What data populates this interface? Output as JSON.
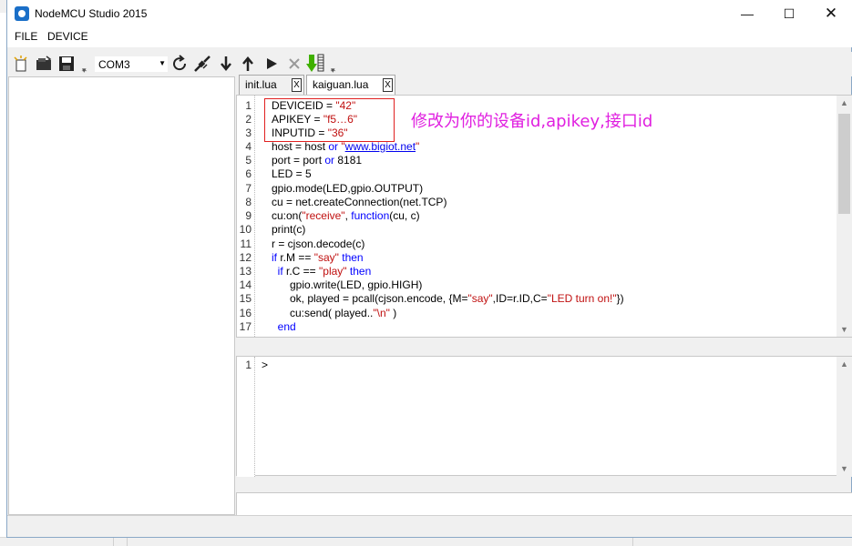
{
  "window": {
    "title": "NodeMCU Studio 2015",
    "minimize_glyph": "—",
    "maximize_glyph": "☐",
    "close_glyph": "✕"
  },
  "menu": {
    "file": "FILE",
    "device": "DEVICE"
  },
  "toolbar": {
    "com_port": "COM3",
    "icons": [
      "new-file-icon",
      "open-file-icon",
      "save-icon",
      "refresh-icon",
      "disconnect-icon",
      "download-icon",
      "upload-icon",
      "run-icon",
      "stop-icon",
      "flash-icon"
    ]
  },
  "tabs": [
    {
      "label": "init.lua",
      "close": "X",
      "active": false
    },
    {
      "label": "kaiguan.lua",
      "close": "X",
      "active": true
    }
  ],
  "editor": {
    "annotation": "修改为你的设备id,apikey,接口id",
    "line_numbers": [
      "1",
      "2",
      "3",
      "4",
      "5",
      "6",
      "7",
      "8",
      "9",
      "10",
      "11",
      "12",
      "13",
      "14",
      "15",
      "16",
      "17"
    ],
    "lines": [
      "DEVICEID = \"42\"",
      "APIKEY = \"f5…6\"",
      "INPUTID = \"36\"",
      "host = host or \"www.bigiot.net\"",
      "port = port or 8181",
      "LED = 5",
      "gpio.mode(LED,gpio.OUTPUT)",
      "cu = net.createConnection(net.TCP)",
      "cu:on(\"receive\", function(cu, c)",
      "print(c)",
      "r = cjson.decode(c)",
      "if r.M == \"say\" then",
      "  if r.C == \"play\" then",
      "      gpio.write(LED, gpio.HIGH)",
      "      ok, played = pcall(cjson.encode, {M=\"say\",ID=r.ID,C=\"LED turn on!\"})",
      "      cu:send( played..\"\\n\" )",
      "  end"
    ]
  },
  "console": {
    "line_number": "1",
    "prompt": ">"
  },
  "colors": {
    "keyword": "#0000ff",
    "string": "#c01010",
    "annotation": "#e020e0",
    "annotation_box": "#e02020"
  }
}
